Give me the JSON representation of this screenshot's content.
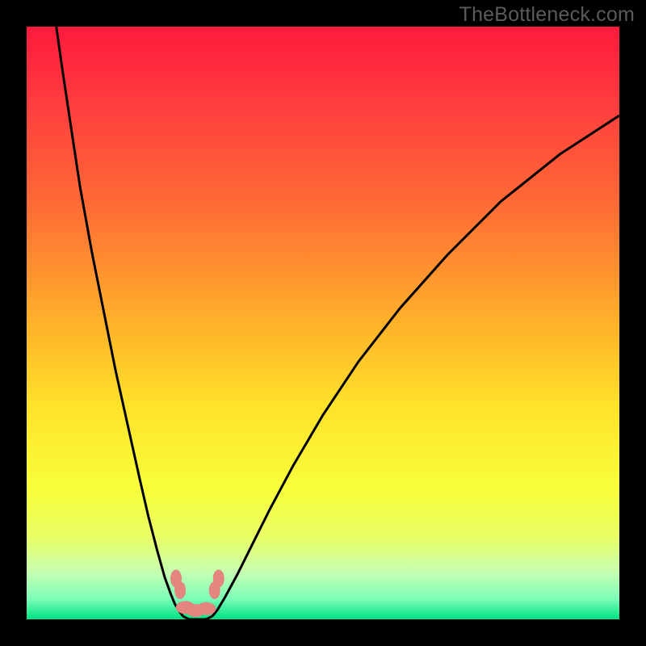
{
  "watermark": "TheBottleneck.com",
  "colors": {
    "page_bg": "#000000",
    "curve_stroke": "#000000",
    "marker_fill": "#e38680",
    "gradient_stops": [
      {
        "offset": 0.0,
        "color": "#ff1a3c"
      },
      {
        "offset": 0.12,
        "color": "#ff3a3f"
      },
      {
        "offset": 0.3,
        "color": "#ff6b35"
      },
      {
        "offset": 0.5,
        "color": "#ffb12a"
      },
      {
        "offset": 0.64,
        "color": "#ffe22a"
      },
      {
        "offset": 0.78,
        "color": "#f8ff3a"
      },
      {
        "offset": 0.86,
        "color": "#eaff65"
      },
      {
        "offset": 0.92,
        "color": "#c7ffb0"
      },
      {
        "offset": 0.965,
        "color": "#7dffb8"
      },
      {
        "offset": 1.0,
        "color": "#00e183"
      }
    ]
  },
  "chart_data": {
    "type": "line",
    "title": "",
    "xlabel": "",
    "ylabel": "",
    "xlim": [
      0,
      100
    ],
    "ylim": [
      0,
      100
    ],
    "grid": false,
    "legend": null,
    "series": [
      {
        "name": "left-branch",
        "x": [
          5,
          6,
          7.5,
          9,
          11,
          13,
          15,
          17,
          19,
          20.5,
          22,
          23.3,
          24.3,
          25,
          25.8,
          26.4
        ],
        "y": [
          100,
          93,
          83,
          73,
          62,
          52,
          42,
          33,
          24,
          17.5,
          11.7,
          7.1,
          4.3,
          2.6,
          1.3,
          0.5
        ]
      },
      {
        "name": "minimum-floor",
        "x": [
          26.4,
          27.4,
          28.8,
          30.2,
          31.3
        ],
        "y": [
          0.5,
          0.0,
          0.0,
          0.0,
          0.5
        ]
      },
      {
        "name": "right-branch",
        "x": [
          31.3,
          32.2,
          33.5,
          35.5,
          38,
          41,
          45,
          50,
          56,
          63,
          71,
          80,
          90,
          100
        ],
        "y": [
          0.5,
          1.6,
          3.8,
          7.5,
          12.5,
          18.5,
          26,
          34.5,
          43.5,
          52.5,
          61.5,
          70.5,
          78.5,
          85
        ]
      }
    ],
    "markers": [
      {
        "name": "m-left-upper",
        "x": 25.2,
        "y": 6.9
      },
      {
        "name": "m-left-lower",
        "x": 25.9,
        "y": 4.9
      },
      {
        "name": "m-right-lower",
        "x": 31.7,
        "y": 4.9
      },
      {
        "name": "m-right-upper",
        "x": 32.4,
        "y": 6.9
      },
      {
        "name": "m-floor-a",
        "x": 26.8,
        "y": 2.0
      },
      {
        "name": "m-floor-b",
        "x": 28.5,
        "y": 1.5
      },
      {
        "name": "m-floor-c",
        "x": 30.3,
        "y": 1.8
      }
    ]
  }
}
